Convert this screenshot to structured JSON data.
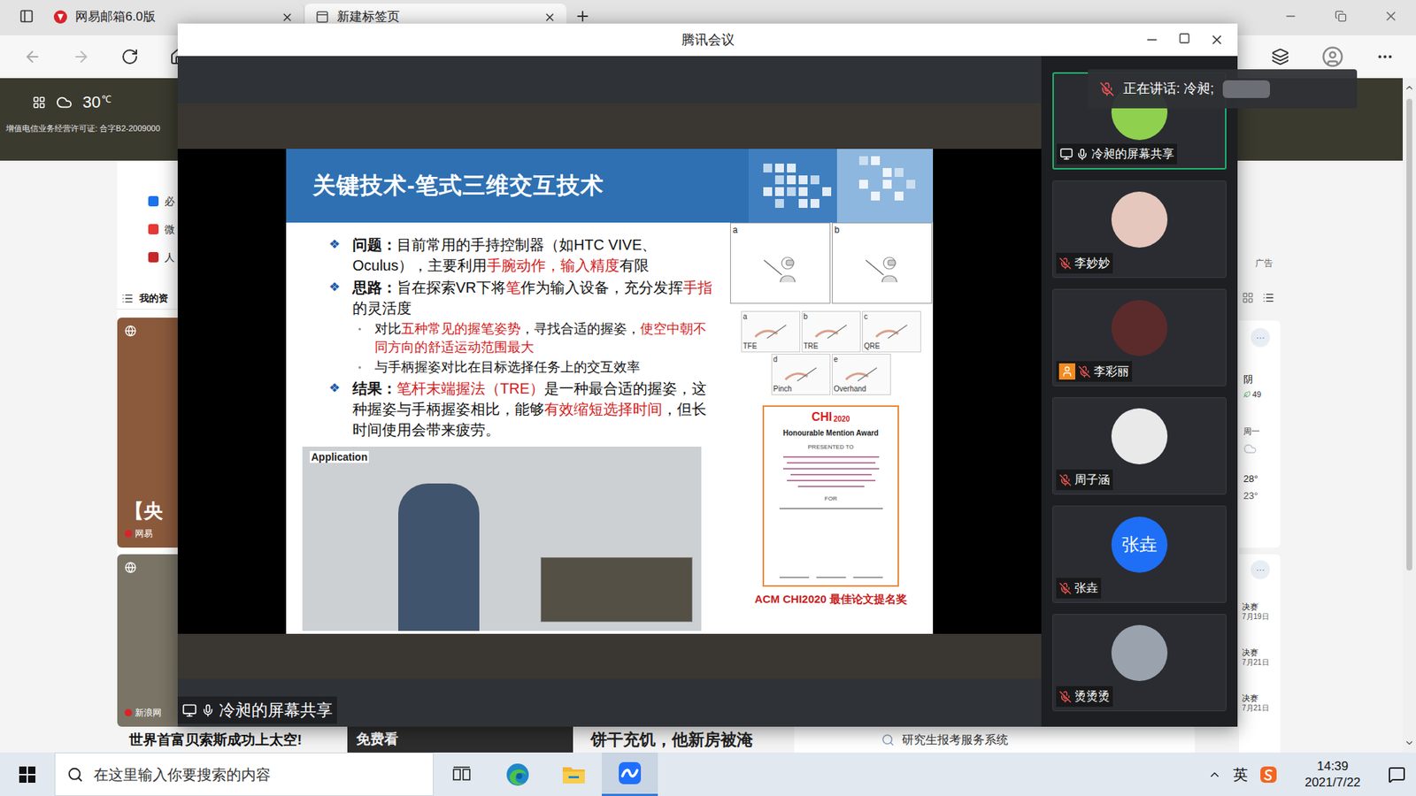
{
  "browser": {
    "tabs": [
      {
        "label": "网易邮箱6.0版",
        "selected": false
      },
      {
        "label": "新建标签页",
        "selected": true
      }
    ],
    "hero": {
      "temperature": "30",
      "unit": "℃",
      "license": "增值电信业务经营许可证: 合字B2-2009000"
    },
    "nav": [
      {
        "label": "必",
        "color": "#1a73e8"
      },
      {
        "label": "微",
        "color": "#e53935"
      },
      {
        "label": "人",
        "color": "#c62828"
      }
    ],
    "feed_tab": "我的资",
    "cards": [
      {
        "headline": "【央",
        "source": "网易"
      },
      {
        "source": "新浪网"
      }
    ],
    "strip": {
      "headline": "世界首富贝索斯成功上太空!",
      "promo": "免费看",
      "news": "饼干充饥，他新房被淹",
      "suggestion": "研究生报考服务系统"
    },
    "rail": {
      "ad": "广告",
      "weather": {
        "more": "···",
        "condition": "阴",
        "aqi": "49",
        "day": "周一",
        "high": "28°",
        "low": "23°"
      },
      "schedule": {
        "more": "···",
        "items": [
          {
            "title": "决赛",
            "date": "7月19日"
          },
          {
            "title": "决赛",
            "date": "7月21日"
          },
          {
            "title": "决赛",
            "date": "7月21日"
          }
        ]
      }
    }
  },
  "meeting": {
    "title": "腾讯会议",
    "speaker": {
      "text": "正在讲话: 冷昶;",
      "muted": true
    },
    "share_label": "冷昶的屏幕共享",
    "participants": [
      {
        "name": "冷昶的屏幕共享",
        "muted": false,
        "sharing": true,
        "badge": false,
        "selected": true,
        "color": "#8fd14f"
      },
      {
        "name": "李妙妙",
        "muted": true,
        "sharing": false,
        "badge": false,
        "selected": false,
        "color": "#e6c7bd"
      },
      {
        "name": "李彩丽",
        "muted": true,
        "sharing": false,
        "badge": true,
        "selected": false,
        "color": "#5b2b2b"
      },
      {
        "name": "周子涵",
        "muted": true,
        "sharing": false,
        "badge": false,
        "selected": false,
        "color": "#e9e9e9"
      },
      {
        "name": "张垚",
        "muted": true,
        "sharing": false,
        "badge": false,
        "selected": false,
        "color": "#1e6ff5",
        "avatar_text": "张垚"
      },
      {
        "name": "烫烫烫",
        "muted": true,
        "sharing": false,
        "badge": false,
        "selected": false,
        "color": "#9aa3ad"
      }
    ],
    "slide": {
      "title": "关键技术-笔式三维交互技术",
      "bullets": [
        {
          "kind": "main",
          "marker": "❖",
          "segments": [
            {
              "text": "问题：",
              "bold": true,
              "red": false
            },
            {
              "text": "目前常用的手持控制器（如HTC VIVE、Oculus），主要利用",
              "bold": false,
              "red": false
            },
            {
              "text": "手腕动作，输入精度",
              "bold": false,
              "red": true
            },
            {
              "text": "有限",
              "bold": false,
              "red": false
            }
          ]
        },
        {
          "kind": "main",
          "marker": "❖",
          "segments": [
            {
              "text": "思路：",
              "bold": true,
              "red": false
            },
            {
              "text": "旨在探索VR下将",
              "bold": false,
              "red": false
            },
            {
              "text": "笔",
              "bold": false,
              "red": true
            },
            {
              "text": "作为输入设备，充分发挥",
              "bold": false,
              "red": false
            },
            {
              "text": "手指",
              "bold": false,
              "red": true
            },
            {
              "text": "的灵活度",
              "bold": false,
              "red": false
            }
          ]
        },
        {
          "kind": "sub",
          "marker": "▪",
          "segments": [
            {
              "text": "对比",
              "bold": false,
              "red": false
            },
            {
              "text": "五种常见的握笔姿势",
              "bold": false,
              "red": true
            },
            {
              "text": "，寻找合适的握姿，",
              "bold": false,
              "red": false
            },
            {
              "text": "使空中朝不同方向的舒适运动范围最大",
              "bold": false,
              "red": true
            }
          ]
        },
        {
          "kind": "sub",
          "marker": "▪",
          "segments": [
            {
              "text": "与手柄握姿对比在目标选择任务上的交互效率",
              "bold": false,
              "red": false
            }
          ]
        },
        {
          "kind": "main",
          "marker": "❖",
          "segments": [
            {
              "text": "结果：",
              "bold": true,
              "red": false
            },
            {
              "text": "笔杆末端握法（TRE）",
              "bold": false,
              "red": true
            },
            {
              "text": "是一种最合适的握姿，这种握姿与手柄握姿相比，能够",
              "bold": false,
              "red": false
            },
            {
              "text": "有效缩短选择时间",
              "bold": false,
              "red": true
            },
            {
              "text": "，但长时间使用会带来疲劳。",
              "bold": false,
              "red": false
            }
          ]
        }
      ],
      "application_label": "Application",
      "top_figures": [
        {
          "label": "a"
        },
        {
          "label": "b"
        }
      ],
      "grips": [
        {
          "label": "a",
          "caption": "TFE"
        },
        {
          "label": "b",
          "caption": "TRE"
        },
        {
          "label": "c",
          "caption": "QRE"
        },
        {
          "label": "d",
          "caption": "Pinch"
        },
        {
          "label": "e",
          "caption": "Overhand"
        }
      ],
      "award": {
        "logo": "CHI",
        "year": "2020",
        "title": "Honourable Mention Award",
        "presented": "PRESENTED TO",
        "for": "FOR",
        "caption": "ACM CHI2020 最佳论文提名奖"
      }
    }
  },
  "taskbar": {
    "search_placeholder": "在这里输入你要搜索的内容",
    "apps": [
      {
        "kind": "taskview",
        "active": false
      },
      {
        "kind": "edge",
        "active": false
      },
      {
        "kind": "folder",
        "active": false
      },
      {
        "kind": "meeting",
        "active": true
      }
    ],
    "ime": "英",
    "time": "14:39",
    "date": "2021/7/22"
  }
}
